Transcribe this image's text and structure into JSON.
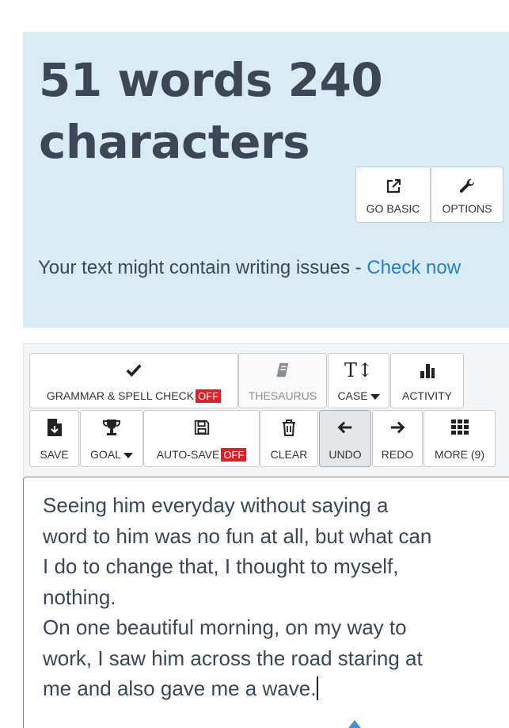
{
  "counter": {
    "text": "51 words 240 characters"
  },
  "hero_buttons": {
    "go_basic": {
      "label": "GO BASIC",
      "icon": "external-link-icon"
    },
    "options": {
      "label": "OPTIONS",
      "icon": "wrench-icon"
    }
  },
  "issues": {
    "prefix": "Your text might contain writing issues - ",
    "link": "Check now"
  },
  "toolbar": {
    "grammar": {
      "label": "GRAMMAR & SPELL CHECK",
      "badge": "OFF",
      "icon": "check-icon"
    },
    "thesaurus": {
      "label": "THESAURUS",
      "icon": "book-icon"
    },
    "case": {
      "label": "CASE",
      "icon": "text-case-icon"
    },
    "activity": {
      "label": "ACTIVITY",
      "icon": "bar-chart-icon"
    },
    "save": {
      "label": "SAVE",
      "icon": "save-file-icon"
    },
    "goal": {
      "label": "GOAL",
      "icon": "trophy-icon"
    },
    "autosave": {
      "label": "AUTO-SAVE",
      "badge": "OFF",
      "icon": "floppy-icon"
    },
    "clear": {
      "label": "CLEAR",
      "icon": "trash-icon"
    },
    "undo": {
      "label": "UNDO",
      "icon": "arrow-left-icon"
    },
    "redo": {
      "label": "REDO",
      "icon": "arrow-right-icon"
    },
    "more": {
      "label": "MORE (9)",
      "icon": "grid-icon"
    }
  },
  "editor": {
    "text": "Seeing him everyday without saying a\nword to him was no fun at all, but what can\nI do to change that, I thought to myself,\nnothing.\nOn one beautiful morning, on my way to\nwork, I saw him across the road staring at\nme and also gave me a wave."
  },
  "colors": {
    "hero_bg": "#d9ebf5",
    "link": "#2a7fc1",
    "off_badge": "#d9232a",
    "editor_border": "#4a90d9"
  }
}
